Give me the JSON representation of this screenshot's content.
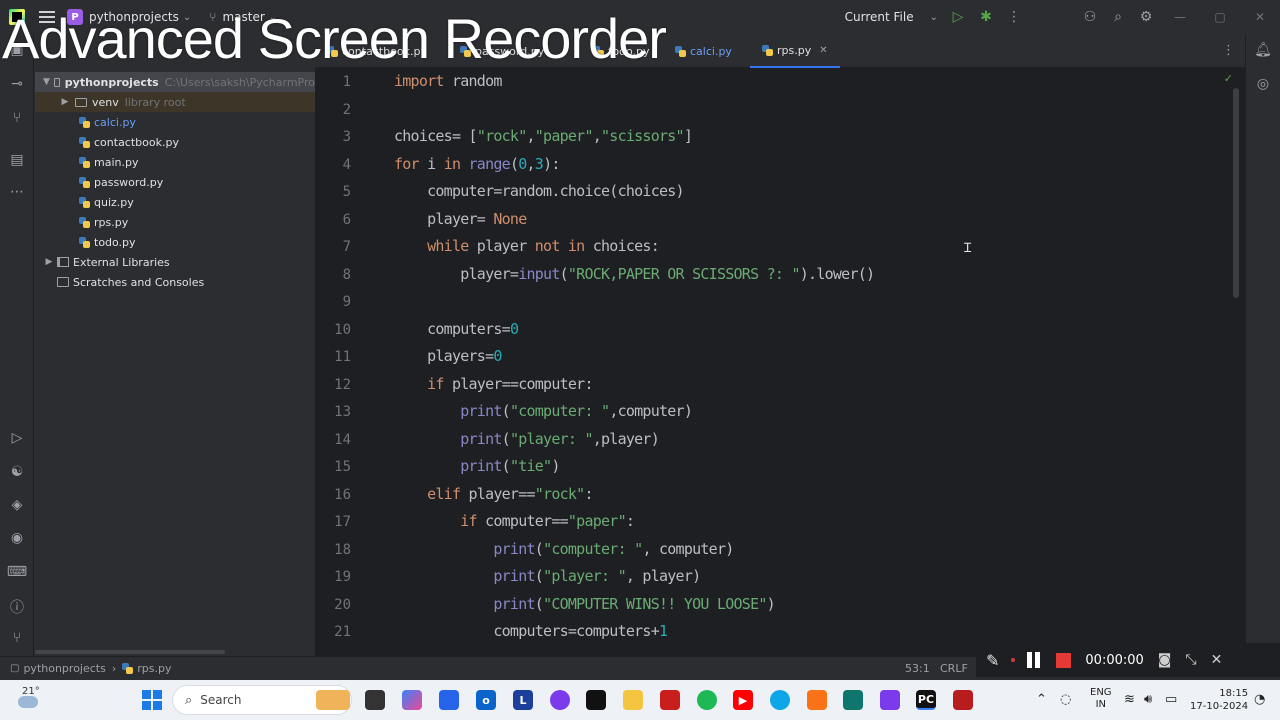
{
  "watermark": "Advanced Screen Recorder",
  "titlebar": {
    "project_badge": "P",
    "project_name": "pythonprojects",
    "branch": "master",
    "run_config": "Current File"
  },
  "project_tree": {
    "root_name": "pythonprojects",
    "root_path": "C:\\Users\\saksh\\PycharmPro",
    "venv": "venv",
    "venv_hint": "library root",
    "files": [
      "calci.py",
      "contactbook.py",
      "main.py",
      "password.py",
      "quiz.py",
      "rps.py",
      "todo.py"
    ],
    "external_libraries": "External Libraries",
    "scratches": "Scratches and Consoles"
  },
  "tabs": [
    {
      "label": "contactbook.py"
    },
    {
      "label": "password.py"
    },
    {
      "label": "todo.py"
    },
    {
      "label": "calci.py"
    },
    {
      "label": "rps.py",
      "active": true
    }
  ],
  "editor": {
    "line_numbers": [
      "1",
      "2",
      "3",
      "4",
      "5",
      "6",
      "7",
      "8",
      "9",
      "10",
      "11",
      "12",
      "13",
      "14",
      "15",
      "16",
      "17",
      "18",
      "19",
      "20",
      "21"
    ]
  },
  "statusbar": {
    "project": "pythonprojects",
    "file": "rps.py",
    "position": "53:1",
    "line_ending": "CRLF"
  },
  "recorder": {
    "time": "00:00:00"
  },
  "taskbar": {
    "temperature": "21°",
    "search_label": "Search",
    "lang_top": "ENG",
    "lang_bottom": "IN",
    "time": "18:15",
    "date": "17-10-2024"
  },
  "colors": {
    "keyword": "#cf8e6d",
    "string": "#6aab73",
    "number": "#2aacb8",
    "builtin": "#8888c6",
    "accent": "#3574f0"
  }
}
